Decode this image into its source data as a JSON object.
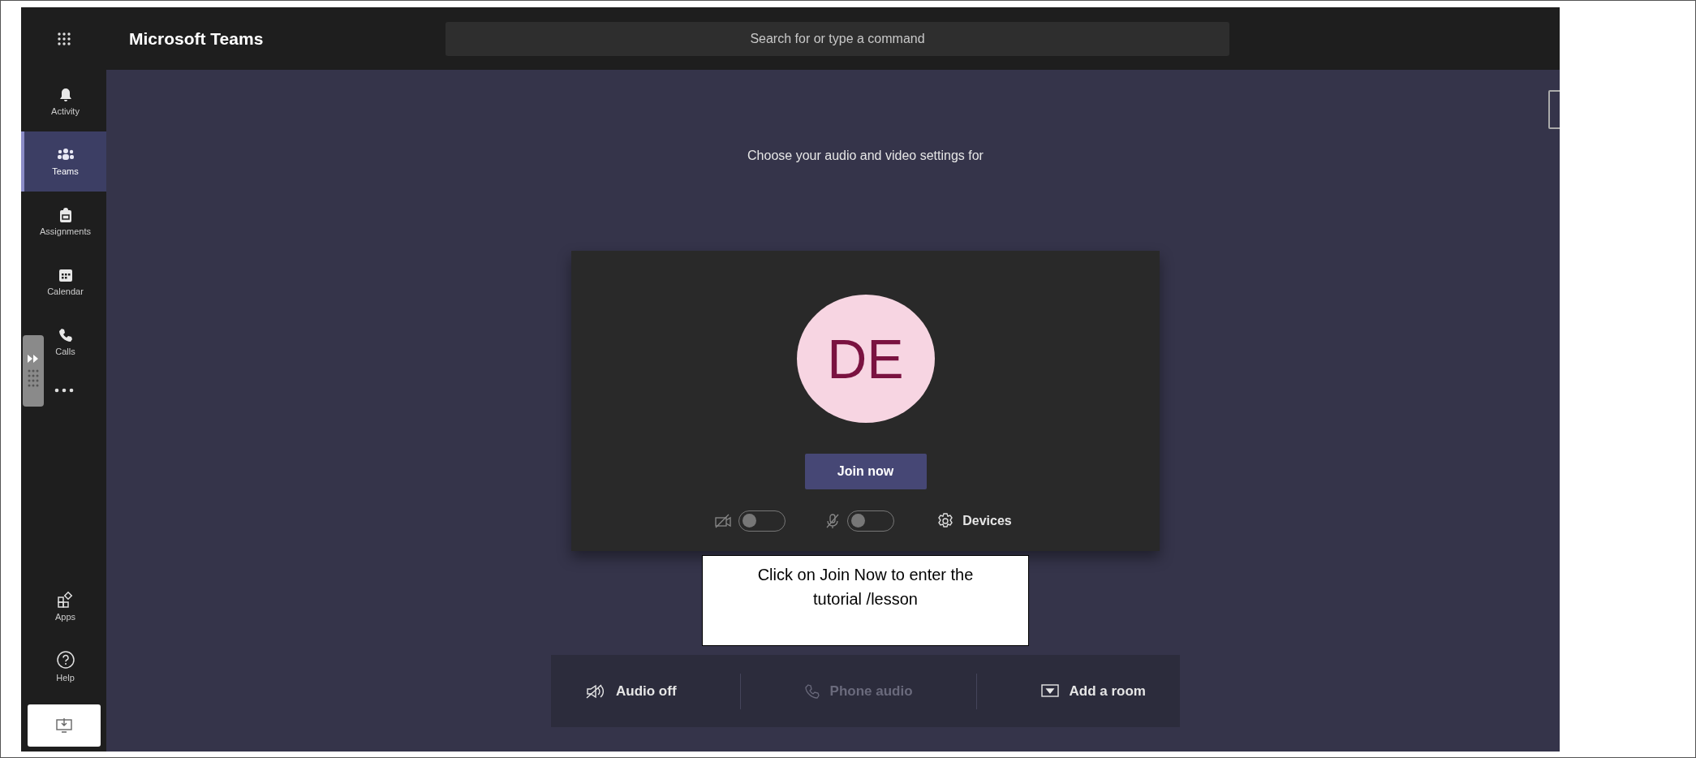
{
  "app": {
    "title": "Microsoft Teams"
  },
  "search": {
    "placeholder": "Search for or type a command"
  },
  "nav": {
    "items": [
      {
        "label": "Activity",
        "kind": "bell",
        "selected": false
      },
      {
        "label": "Teams",
        "kind": "teams",
        "selected": true
      },
      {
        "label": "Assignments",
        "kind": "bag",
        "selected": false
      },
      {
        "label": "Calendar",
        "kind": "calendar",
        "selected": false
      },
      {
        "label": "Calls",
        "kind": "phone",
        "selected": false
      }
    ],
    "bottom_items": [
      {
        "label": "Apps",
        "kind": "apps",
        "selected": false
      },
      {
        "label": "Help",
        "kind": "help",
        "selected": false
      }
    ]
  },
  "prejoin": {
    "heading": "Choose your audio and video settings for",
    "avatar_initials": "DE",
    "join_button": "Join now",
    "camera": {
      "on": false
    },
    "microphone": {
      "on": false
    },
    "devices": "Devices"
  },
  "callout": "Click on Join Now to enter the tutorial /lesson",
  "audio_options": [
    {
      "label": "Audio off",
      "kind": "audio",
      "disabled": false
    },
    {
      "label": "Phone audio",
      "kind": "phone",
      "disabled": true
    },
    {
      "label": "Add a room",
      "kind": "room",
      "disabled": false
    }
  ]
}
